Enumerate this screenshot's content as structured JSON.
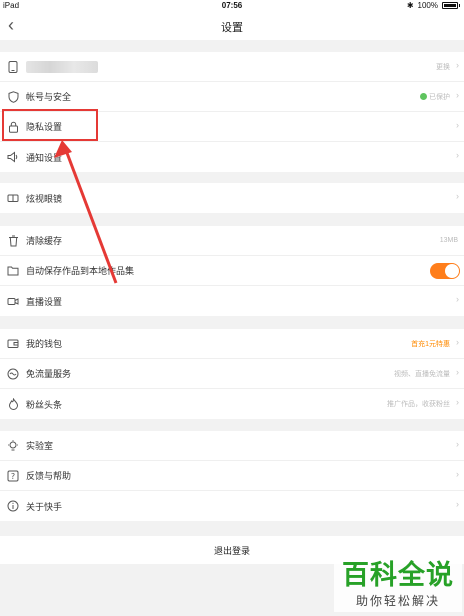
{
  "status_bar": {
    "device": "iPad",
    "time": "07:56",
    "battery": "100%"
  },
  "nav": {
    "title": "设置"
  },
  "group1": [
    {
      "label": "",
      "value": "更换",
      "icon": "phone-icon"
    },
    {
      "label": "帐号与安全",
      "value": "已保护",
      "icon": "shield-icon"
    },
    {
      "label": "隐私设置",
      "value": "",
      "icon": "lock-icon"
    },
    {
      "label": "通知设置",
      "value": "",
      "icon": "speaker-icon"
    }
  ],
  "group2": [
    {
      "label": "炫视眼镜",
      "value": "",
      "icon": "glasses-icon"
    }
  ],
  "group3": [
    {
      "label": "清除缓存",
      "value": "13MB",
      "icon": "trash-icon"
    },
    {
      "label": "自动保存作品到本地作品集",
      "value": "",
      "icon": "folder-icon",
      "toggle_on": true
    },
    {
      "label": "直播设置",
      "value": "",
      "icon": "camera-icon"
    }
  ],
  "group4": [
    {
      "label": "我的钱包",
      "value": "首充1元特惠",
      "icon": "wallet-icon",
      "value_color": "#ff8a00"
    },
    {
      "label": "免流量服务",
      "value": "视频、直播免流量",
      "icon": "infinity-icon"
    },
    {
      "label": "粉丝头条",
      "value": "推广作品，收获粉丝",
      "icon": "flame-icon"
    }
  ],
  "group5": [
    {
      "label": "实验室",
      "value": "",
      "icon": "bulb-icon"
    },
    {
      "label": "反馈与帮助",
      "value": "",
      "icon": "help-icon"
    },
    {
      "label": "关于快手",
      "value": "",
      "icon": "info-icon"
    }
  ],
  "logout": "退出登录",
  "watermark": {
    "main": "百科全说",
    "sub": "助你轻松解决"
  }
}
